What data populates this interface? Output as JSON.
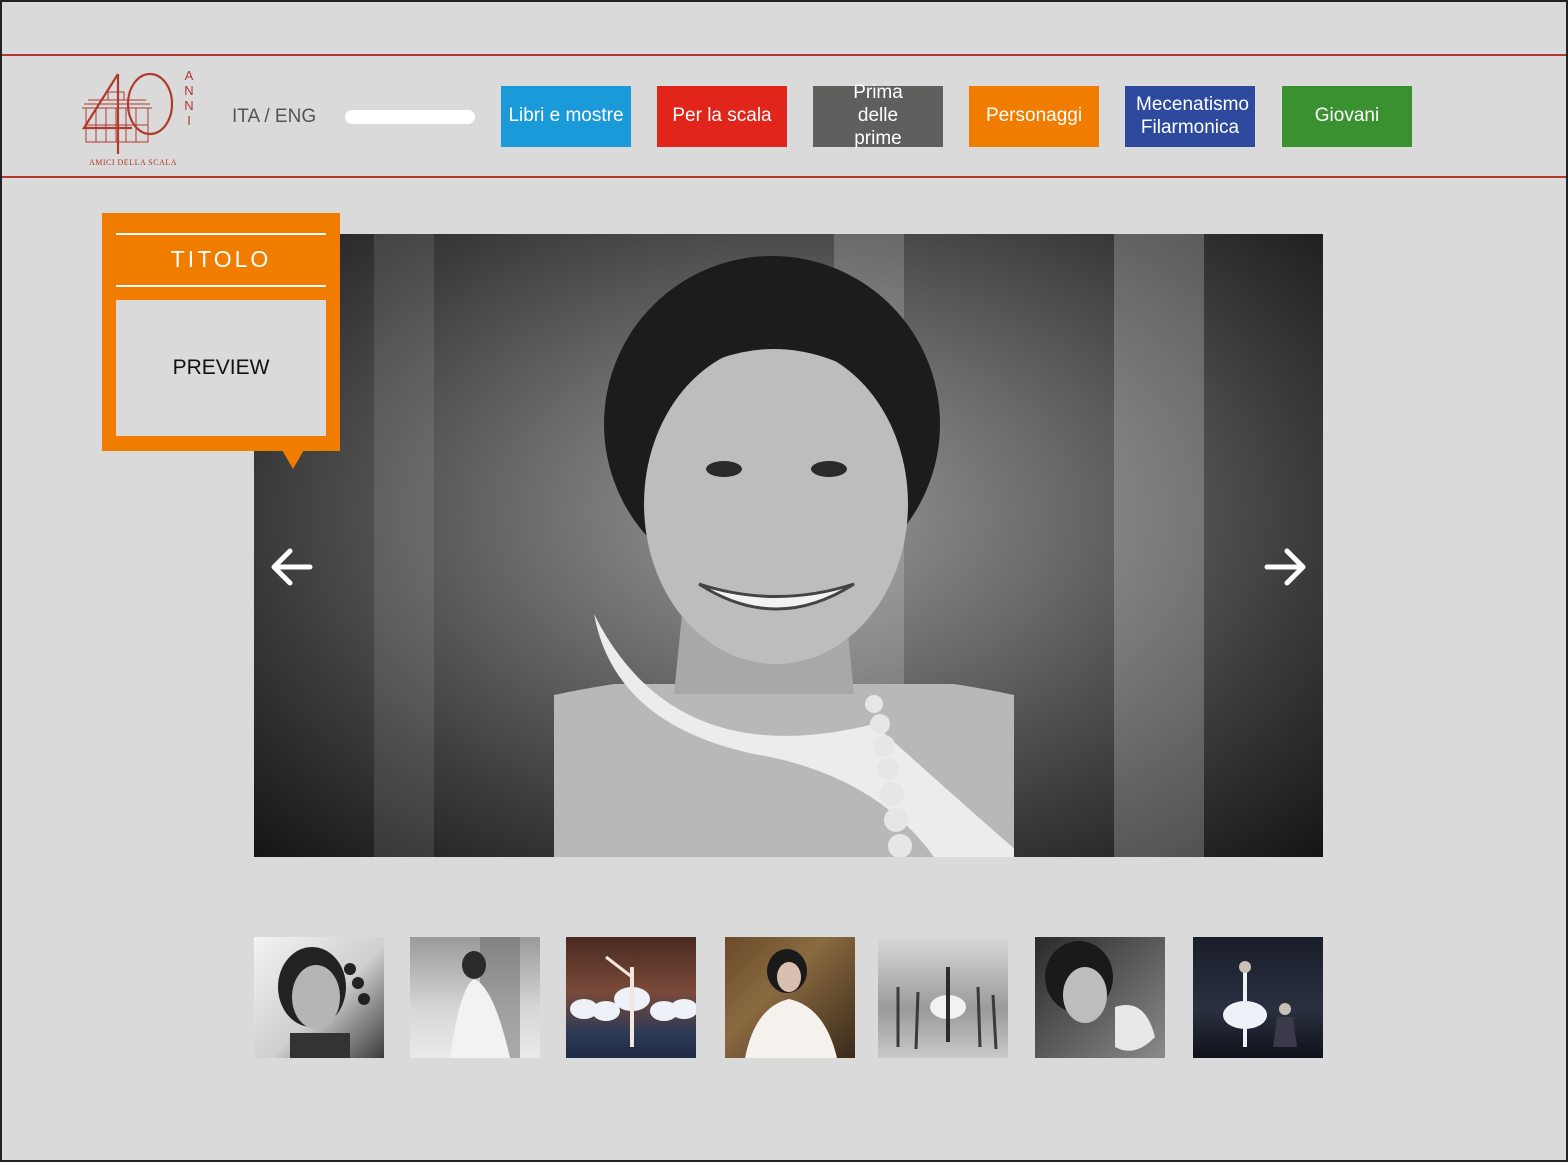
{
  "header": {
    "logo": {
      "number": "40",
      "word": "ANNI",
      "caption": "AMICI DELLA SCALA"
    },
    "lang_switch": "ITA / ENG",
    "search": {
      "placeholder": ""
    },
    "nav": [
      {
        "label": "Libri e mostre",
        "color": "#1a9ad9"
      },
      {
        "label": "Per la scala",
        "color": "#e1251b"
      },
      {
        "label": "Prima delle prime",
        "color": "#5f5f5e"
      },
      {
        "label": "Personaggi",
        "color": "#f07c00"
      },
      {
        "label": "Mecenatismo Filarmonica",
        "color": "#2e4a9e"
      },
      {
        "label": "Giovani",
        "color": "#3a9130"
      }
    ]
  },
  "callout": {
    "title": "TITOLO",
    "preview": "PREVIEW",
    "color": "#f07c00"
  },
  "carousel": {
    "prev_icon": "arrow-left-icon",
    "next_icon": "arrow-right-icon",
    "thumbnails": [
      "portrait-thumbnail",
      "seated-dancer-thumbnail",
      "ballet-stage-thumbnail",
      "armchair-portrait-thumbnail",
      "rehearsal-studio-thumbnail",
      "pointe-shoe-thumbnail",
      "stage-scene-thumbnail"
    ]
  },
  "colors": {
    "background": "#dadada",
    "header_rule": "#b03a2e",
    "accent": "#f07c00"
  }
}
